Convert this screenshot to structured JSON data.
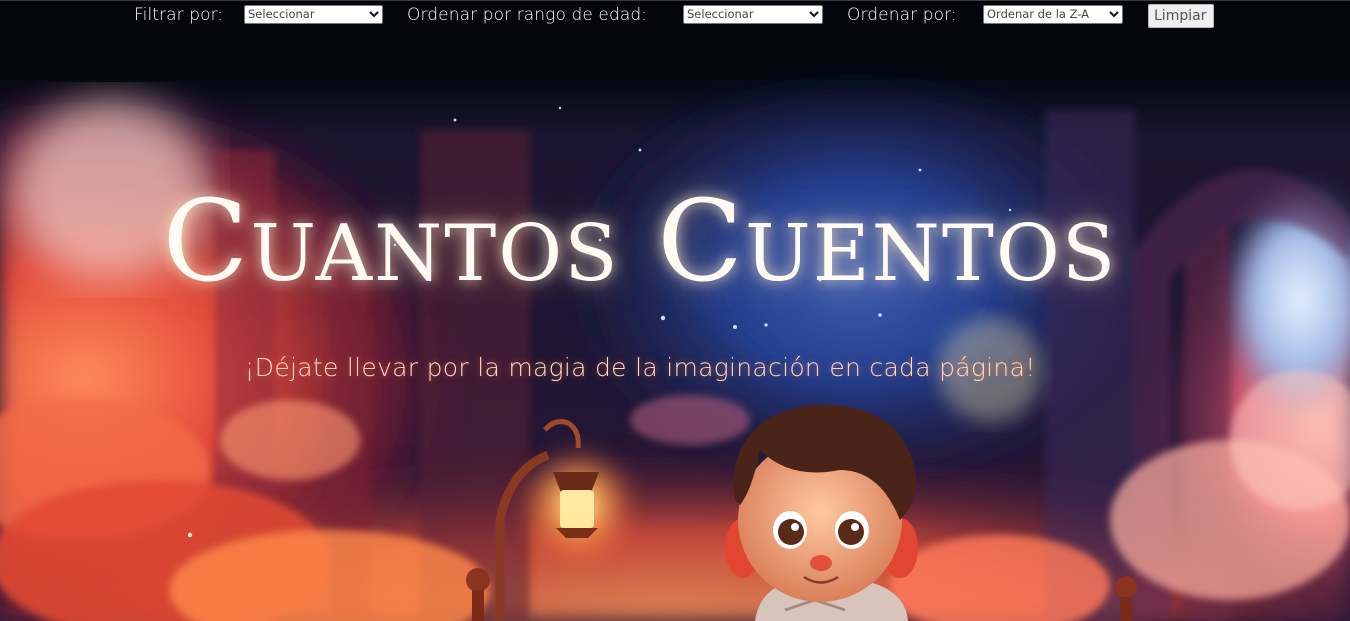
{
  "filters": {
    "filter_label": "Filtrar por:",
    "filter_value": "Seleccionar",
    "age_label": "Ordenar por rango de edad:",
    "age_value": "Seleccionar",
    "sort_label": "Ordenar por:",
    "sort_value": "Ordenar de la Z-A",
    "clear_label": "Limpiar"
  },
  "hero": {
    "title": "Cuantos Cuentos",
    "subtitle": "¡Déjate llevar por la magia de la imaginación en cada página!"
  },
  "colors": {
    "topbar": "#03060a",
    "sky_night": "#1b2a6e",
    "clouds_warm": "#f0603a",
    "title_text": "#fffaf2",
    "subtitle_text": "#ffd9c6"
  },
  "icons": {
    "select_arrow": "chevron-down-icon",
    "lamp": "lantern-icon",
    "moon": "crescent-moon-icon"
  }
}
